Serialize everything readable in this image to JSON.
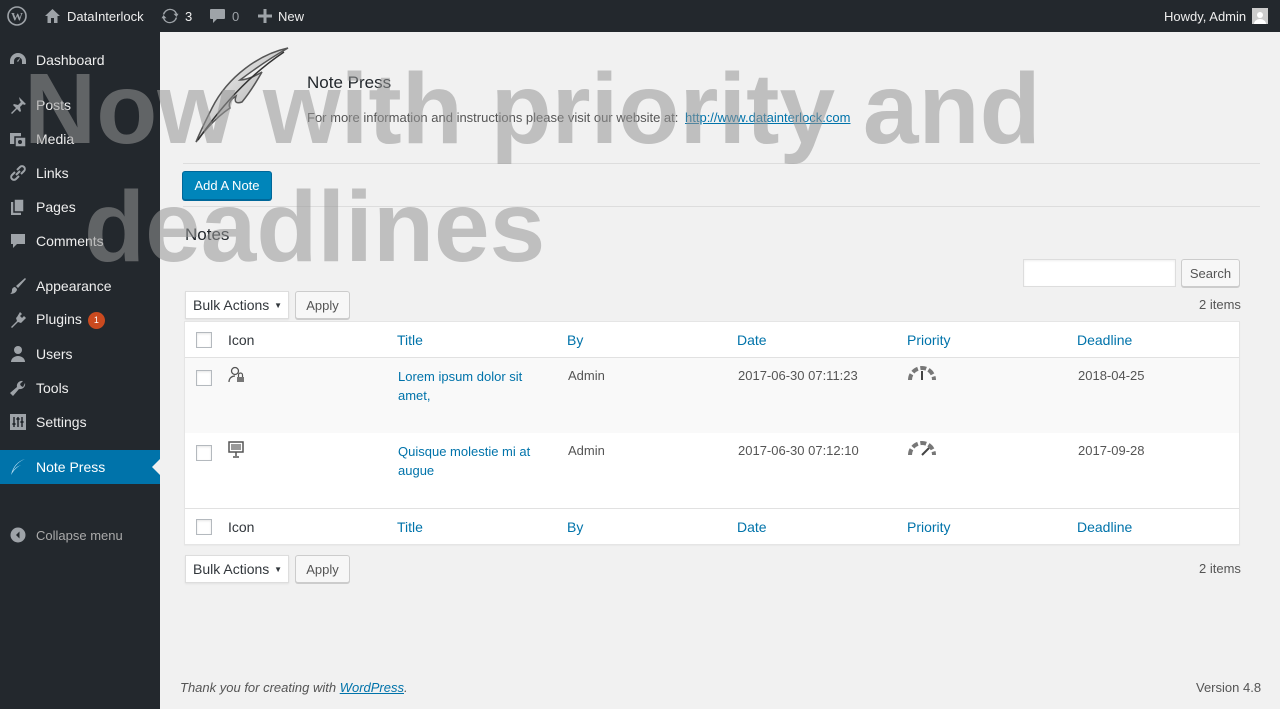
{
  "adminbar": {
    "site_name": "DataInterlock",
    "updates_count": "3",
    "comments_count": "0",
    "new_label": "New",
    "greeting": "Howdy, Admin"
  },
  "sidebar": {
    "items": [
      {
        "label": "Dashboard",
        "icon": "dashboard-icon"
      },
      {
        "label": "Posts",
        "icon": "pin-icon"
      },
      {
        "label": "Media",
        "icon": "media-icon"
      },
      {
        "label": "Links",
        "icon": "link-icon"
      },
      {
        "label": "Pages",
        "icon": "pages-icon"
      },
      {
        "label": "Comments",
        "icon": "comment-icon"
      },
      {
        "label": "Appearance",
        "icon": "brush-icon"
      },
      {
        "label": "Plugins",
        "icon": "plugin-icon",
        "badge": "1"
      },
      {
        "label": "Users",
        "icon": "user-icon"
      },
      {
        "label": "Tools",
        "icon": "wrench-icon"
      },
      {
        "label": "Settings",
        "icon": "settings-icon"
      },
      {
        "label": "Note Press",
        "icon": "feather-icon",
        "active": true
      }
    ],
    "collapse_label": "Collapse menu"
  },
  "plugin": {
    "title": "Note Press",
    "info_text": "For more information and instructions please visit our website at:",
    "website_link": "http://www.datainterlock.com",
    "add_button": "Add A Note",
    "notes_heading": "Notes"
  },
  "overlay": {
    "line1": "Now with priority and",
    "line2": "deadlines"
  },
  "search": {
    "button": "Search",
    "value": ""
  },
  "bulk": {
    "label": "Bulk Actions",
    "apply": "Apply",
    "items_count": "2 items"
  },
  "table": {
    "columns": [
      "Icon",
      "Title",
      "By",
      "Date",
      "Priority",
      "Deadline"
    ],
    "rows": [
      {
        "icon": "user-lock-icon",
        "title": "Lorem ipsum dolor sit amet,",
        "by": "Admin",
        "date": "2017-06-30 07:11:23",
        "priority_icon": "gauge-medium-icon",
        "deadline": "2018-04-25"
      },
      {
        "icon": "monitor-icon",
        "title": "Quisque molestie mi at augue",
        "by": "Admin",
        "date": "2017-06-30 07:12:10",
        "priority_icon": "gauge-high-icon",
        "deadline": "2017-09-28"
      }
    ]
  },
  "footer": {
    "thanks_prefix": "Thank you for creating with",
    "wordpress_link": "WordPress",
    "thanks_suffix": ".",
    "version": "Version 4.8"
  },
  "colors": {
    "accent": "#0073aa",
    "sidebar_bg": "#23282d",
    "badge": "#ca4a1f"
  }
}
